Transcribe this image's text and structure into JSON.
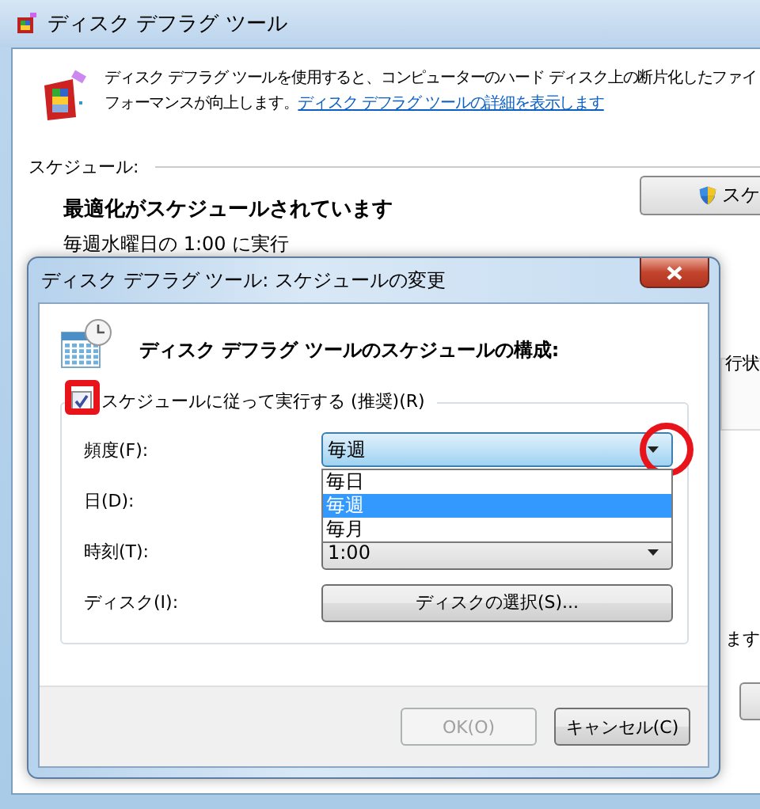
{
  "window": {
    "title": "ディスク デフラグ ツール"
  },
  "description": {
    "line_1": "ディスク デフラグ ツールを使用すると、コンピューターのハード ディスク上の断片化したファイ",
    "line_2": "フォーマンスが向上します。",
    "link": "ディスク デフラグ ツールの詳細を表示します"
  },
  "schedule": {
    "heading": "スケジュール:",
    "status": "最適化がスケジュールされています",
    "detail": "毎週水曜日の 1:00 に実行",
    "button": "スケ"
  },
  "partial_texts": [
    "行状",
    "ます"
  ],
  "dialog": {
    "title": "ディスク デフラグ ツール: スケジュールの変更",
    "heading": "ディスク デフラグ ツールのスケジュールの構成:",
    "run_on_schedule": {
      "label": "スケジュールに従って実行する (推奨)(R)",
      "checked": true,
      "highlighted": true
    },
    "frequency": {
      "label": "頻度(F):",
      "value": "毎週",
      "expanded": true,
      "highlighted": true,
      "options": [
        {
          "label": "毎日",
          "selected": false
        },
        {
          "label": "毎週",
          "selected": true
        },
        {
          "label": "毎月",
          "selected": false
        }
      ]
    },
    "day": {
      "label": "日(D):"
    },
    "time": {
      "label": "時刻(T):",
      "value": "1:00"
    },
    "disk": {
      "label": "ディスク(I):",
      "button": "ディスクの選択(S)..."
    },
    "buttons": [
      {
        "label": "OK(O)",
        "disabled": true
      },
      {
        "label": "キャンセル(C)",
        "disabled": false
      }
    ]
  }
}
